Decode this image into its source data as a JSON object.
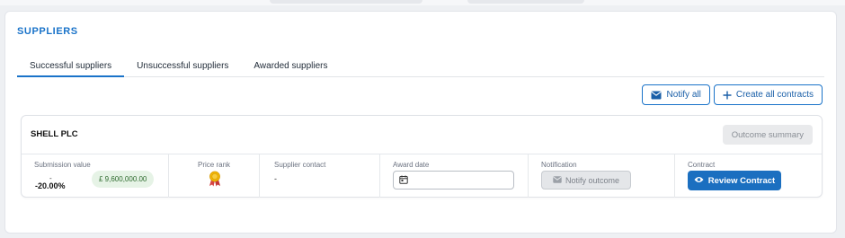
{
  "section_title": "SUPPLIERS",
  "tabs": [
    {
      "label": "Successful suppliers",
      "active": true
    },
    {
      "label": "Unsuccessful suppliers",
      "active": false
    },
    {
      "label": "Awarded suppliers",
      "active": false
    }
  ],
  "actions": {
    "notify_all": "Notify all",
    "create_all_contracts": "Create all contracts"
  },
  "supplier": {
    "name": "SHELL PLC",
    "outcome_summary": "Outcome summary",
    "columns": {
      "submission_value": {
        "label": "Submission value",
        "dash": "-",
        "percent": "-20.00%",
        "amount": "£ 9,600,000.00"
      },
      "price_rank": {
        "label": "Price rank",
        "icon": "medal-icon"
      },
      "supplier_contact": {
        "label": "Supplier contact",
        "value": "-"
      },
      "award_date": {
        "label": "Award date",
        "value": "",
        "icon": "calendar-icon"
      },
      "notification": {
        "label": "Notification",
        "button": "Notify outcome",
        "icon": "envelope-icon"
      },
      "contract": {
        "label": "Contract",
        "button": "Review Contract",
        "icon": "eye-icon"
      }
    }
  },
  "colors": {
    "accent": "#1a73c9",
    "primary_button": "#1b6fc0",
    "amount_badge_bg": "#e6f3e6",
    "amount_badge_text": "#2e6b2e"
  }
}
